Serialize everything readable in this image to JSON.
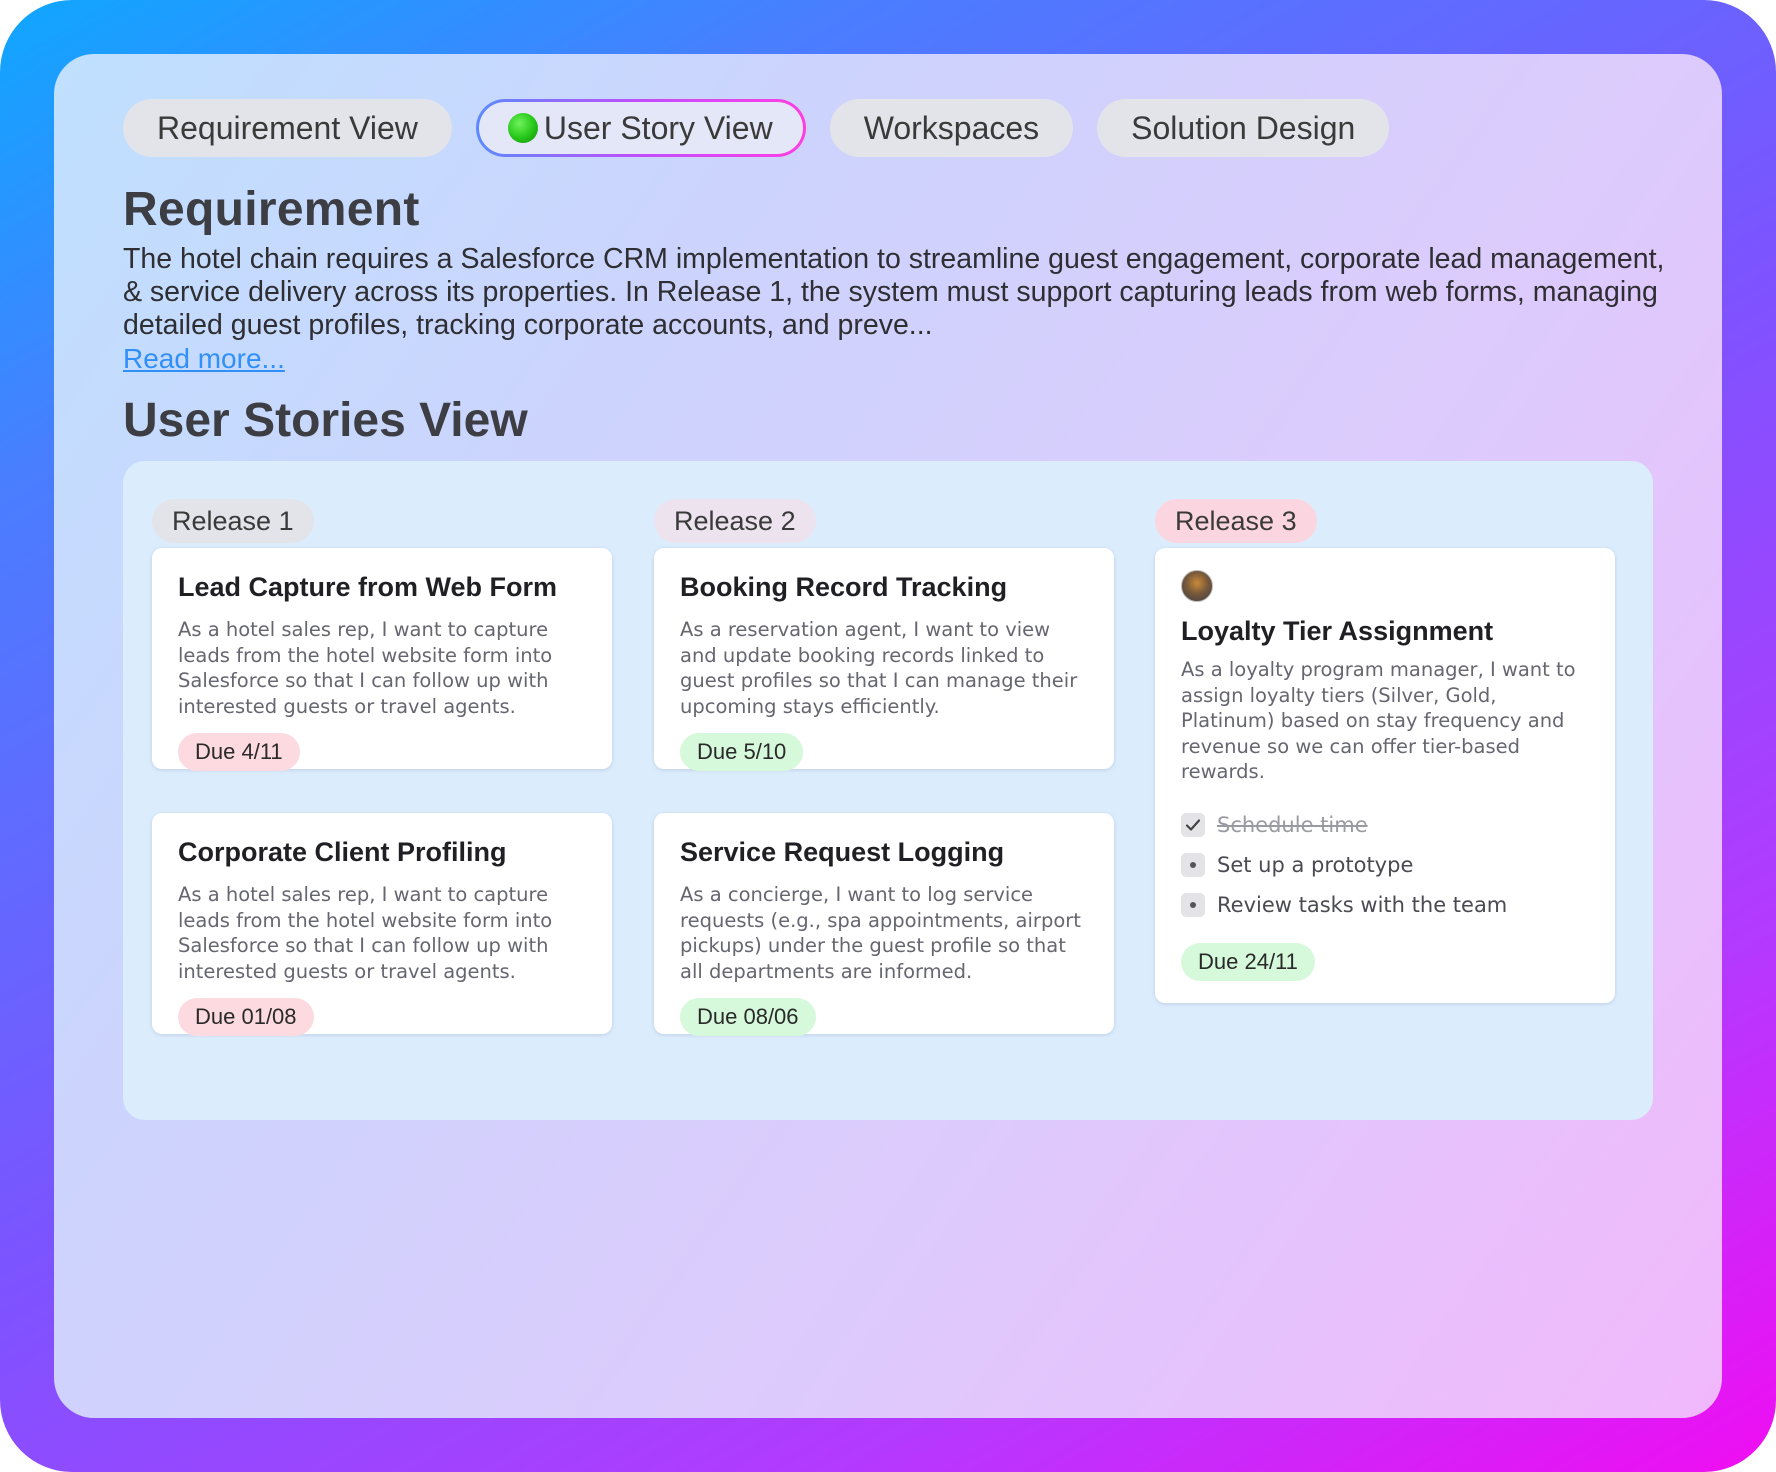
{
  "tabs": [
    {
      "label": "Requirement View",
      "active": false
    },
    {
      "label": "User Story View",
      "active": true
    },
    {
      "label": "Workspaces",
      "active": false
    },
    {
      "label": "Solution Design",
      "active": false
    }
  ],
  "requirement": {
    "title": "Requirement",
    "body": "The hotel chain requires a Salesforce CRM implementation to streamline guest engagement, corporate lead management, & service delivery across its properties. In Release 1, the system must support capturing leads from web forms, managing detailed guest profiles, tracking corporate accounts, and preve...",
    "read_more": "Read more..."
  },
  "stories": {
    "title": "User Stories View",
    "releases": [
      {
        "label": "Release 1",
        "cards": [
          {
            "title": "Lead Capture from Web Form",
            "description": "As a hotel sales rep, I want to capture leads from the hotel website form into Salesforce so that I can follow up with interested guests or travel agents.",
            "due": "Due 4/11",
            "due_color": "#fcdadf"
          },
          {
            "title": "Corporate Client Profiling",
            "description": "As a hotel sales rep, I want to capture leads from the hotel website form into Salesforce so that I can follow up with interested guests or travel agents.",
            "due": "Due 01/08",
            "due_color": "#fcdadf"
          }
        ]
      },
      {
        "label": "Release 2",
        "cards": [
          {
            "title": "Booking Record Tracking",
            "description": "As a reservation agent, I want to view and update booking records linked to guest profiles so that I can manage their upcoming stays efficiently.",
            "due": "Due 5/10",
            "due_color": "#d5f9da"
          },
          {
            "title": "Service Request Logging",
            "description": "As a concierge, I want to log service requests (e.g., spa appointments, airport pickups) under the guest profile so that all departments are informed.",
            "due": "Due 08/06",
            "due_color": "#d5f9da"
          }
        ]
      },
      {
        "label": "Release 3",
        "cards": [
          {
            "title": "Loyalty Tier Assignment",
            "description": "As a loyalty program manager, I want to assign loyalty tiers (Silver, Gold, Platinum) based on stay frequency and revenue so we can offer tier-based rewards.",
            "checklist": [
              {
                "text": "Schedule time",
                "done": true
              },
              {
                "text": "Set up a prototype",
                "done": false
              },
              {
                "text": "Review tasks with the team",
                "done": false
              }
            ],
            "due": "Due 24/11",
            "due_color": "#d5f9da"
          }
        ]
      }
    ]
  },
  "icons": {
    "active_tab_indicator": "green-dot-icon",
    "assignee_avatar": "avatar-icon",
    "checked": "check-icon",
    "unchecked": "bullet-icon"
  }
}
